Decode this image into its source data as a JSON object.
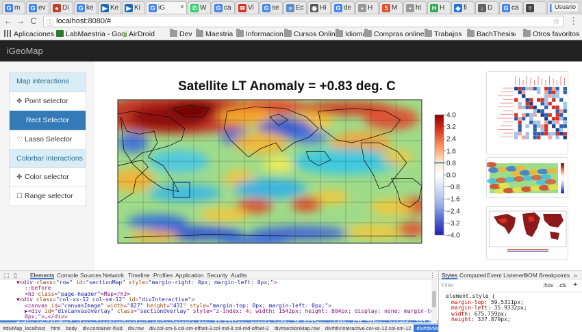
{
  "browser": {
    "tabs": [
      {
        "letter": "G",
        "label": "m",
        "color": "#4285f4"
      },
      {
        "letter": "G",
        "label": "ev",
        "color": "#4285f4"
      },
      {
        "letter": "♠",
        "label": "Di",
        "color": "#c33f2b"
      },
      {
        "letter": "G",
        "label": "ke",
        "color": "#4285f4"
      },
      {
        "letter": "▶",
        "label": "Ke",
        "color": "#1e6bb8"
      },
      {
        "letter": "▶",
        "label": "Ki",
        "color": "#1e6bb8"
      },
      {
        "letter": "G",
        "label": "iG",
        "color": "#4285f4",
        "active": true
      },
      {
        "letter": "✆",
        "label": "W",
        "color": "#25d366"
      },
      {
        "letter": "G",
        "label": "ca",
        "color": "#4285f4"
      },
      {
        "letter": "✉",
        "label": "Vi",
        "color": "#d93025"
      },
      {
        "letter": "G",
        "label": "se",
        "color": "#4285f4"
      },
      {
        "letter": "≡",
        "label": "Ec",
        "color": "#5a8fc8"
      },
      {
        "letter": "◉",
        "label": "Hi",
        "color": "#555555"
      },
      {
        "letter": "G",
        "label": "de",
        "color": "#4285f4"
      },
      {
        "letter": "•",
        "label": "H",
        "color": "#999999"
      },
      {
        "letter": "5",
        "label": "M",
        "color": "#e44d26"
      },
      {
        "letter": "•",
        "label": "ht",
        "color": "#999999"
      },
      {
        "letter": "H",
        "label": "H",
        "color": "#34a853"
      },
      {
        "letter": "◆",
        "label": "fi",
        "color": "#1a73e8"
      },
      {
        "letter": "↓",
        "label": "D",
        "color": "#5f6368"
      },
      {
        "letter": "G",
        "label": "ca",
        "color": "#4285f4"
      },
      {
        "letter": "⁘",
        "label": "",
        "color": "#444444"
      },
      {
        "letter": "G",
        "label": "",
        "color": "#4285f4"
      }
    ],
    "active_tab_close": "×",
    "profile_label": "Usuario",
    "nav": {
      "back": "←",
      "forward": "→",
      "reload": "C"
    },
    "url": "localhost:8080/#",
    "url_info_icon": "ⓘ",
    "star_icon": "☆",
    "menu_icon": "⋮",
    "bookmarks": [
      {
        "label": "Aplicaciones",
        "icon": "apps-grid-icon"
      },
      {
        "label": "LabMaestria - Goo",
        "icon": "document-icon"
      },
      {
        "label": "AirDroid",
        "icon": "airdroid-icon"
      },
      {
        "label": "Dev",
        "icon": "folder-icon"
      },
      {
        "label": "Maestria",
        "icon": "folder-icon"
      },
      {
        "label": "Informacion",
        "icon": "folder-icon"
      },
      {
        "label": "Cursos Online",
        "icon": "folder-icon"
      },
      {
        "label": "Idiomas",
        "icon": "folder-icon"
      },
      {
        "label": "Compras online",
        "icon": "folder-icon"
      },
      {
        "label": "Trabajos",
        "icon": "folder-icon"
      },
      {
        "label": "BachThesis",
        "icon": "folder-icon"
      }
    ],
    "bookmarks_more": "»",
    "other_bookmarks": "Otros favoritos"
  },
  "app": {
    "brand": "iGeoMap",
    "sidebar": [
      {
        "label": "Map interactions",
        "kind": "header"
      },
      {
        "label": "Point selector",
        "icon": "move-icon",
        "glyph": "✥"
      },
      {
        "label": "Rect Selector",
        "kind": "active"
      },
      {
        "label": "Lasso Selector",
        "icon": "lasso-icon",
        "glyph": "♡"
      },
      {
        "label": "Colorbar interactions",
        "kind": "header"
      },
      {
        "label": "Color selector",
        "icon": "move-icon",
        "glyph": "✥"
      },
      {
        "label": "Range selector",
        "icon": "checkbox-icon",
        "glyph": "☐"
      }
    ],
    "map_title": "Satellite LT Anomaly = +0.83 deg. C",
    "colorbar": {
      "ticks": [
        "4.0",
        "3.2",
        "2.4",
        "1.6",
        "0.8",
        "0.0",
        "−0.8",
        "−1.6",
        "−2.4",
        "−3.2",
        "−4.0"
      ],
      "marker_value": 0.8,
      "colors": {
        "high": "#8b0000",
        "mid": "#ffffff",
        "low": "#2020b0"
      }
    }
  },
  "devtools": {
    "tabs": [
      "Elements",
      "Console",
      "Sources",
      "Network",
      "Timeline",
      "Profiles",
      "Application",
      "Security",
      "Audits"
    ],
    "active_tab": "Elements",
    "menu_icon": "⋮",
    "dom_lines": [
      {
        "indent": 4,
        "html": "▼<div class=\"row\" id=\"sectionMap\" style=\"margin-right: 0px; margin-left: 0px;\">"
      },
      {
        "indent": 6,
        "html": "::before"
      },
      {
        "indent": 6,
        "html": "<h3 class=\"page-header\">Map</h3>"
      },
      {
        "indent": 4,
        "html": "▼<div class=\"col-xs-12 col-sm-12\" id=\"divInteractive\">"
      },
      {
        "indent": 6,
        "html": "<canvas id=\"canvasImage\" width=\"827\" height=\"431\" style=\"margin-top: 0px; margin-left: 0px;\">"
      },
      {
        "indent": 6,
        "html": "▶<div id=\"divCanvasOverlay\" class=\"sectionOverlay\" style=\"z-index: 4; width: 1542px; height: 804px; display: none; margin-top: 0px; margin-left:"
      },
      {
        "indent": 6,
        "html": "0px;\">…</div>"
      },
      {
        "indent": 4,
        "html": "▼<div id=\"divMap\" class=\"sectionOverlay\" style=\"margin-top: 59.5311px; margin-left: 35.9332px; width: 675.759px; height: 337.879px; display: block;",
        "selected": true
      }
    ],
    "crumbs": [
      "html",
      "body",
      "div.container-fluid",
      "div.row",
      "div.col-sm-6.col-sm-offset-3.col-md-8.col-md-offset-2",
      "div#sectionMap.row",
      "div#divInteractive.col-xs-12.col-sm-12",
      "div#divMap.sectionOverlay"
    ],
    "crumbs_prefix": "#divMap_localhost",
    "styles": {
      "tabs": [
        "Styles",
        "Computed",
        "Event Listeners",
        "DOM Breakpoints",
        "»"
      ],
      "active_tab": "Styles",
      "filter_placeholder": "Filter",
      "hov": ":hov",
      "cls": ".cls",
      "plus": "+",
      "selector": "element.style {",
      "rules": [
        {
          "prop": "margin-top",
          "value": "59.5311px;"
        },
        {
          "prop": "margin-left",
          "value": "35.9332px;"
        },
        {
          "prop": "width",
          "value": "675.759px;"
        },
        {
          "prop": "height",
          "value": "337.879px;"
        }
      ]
    }
  }
}
